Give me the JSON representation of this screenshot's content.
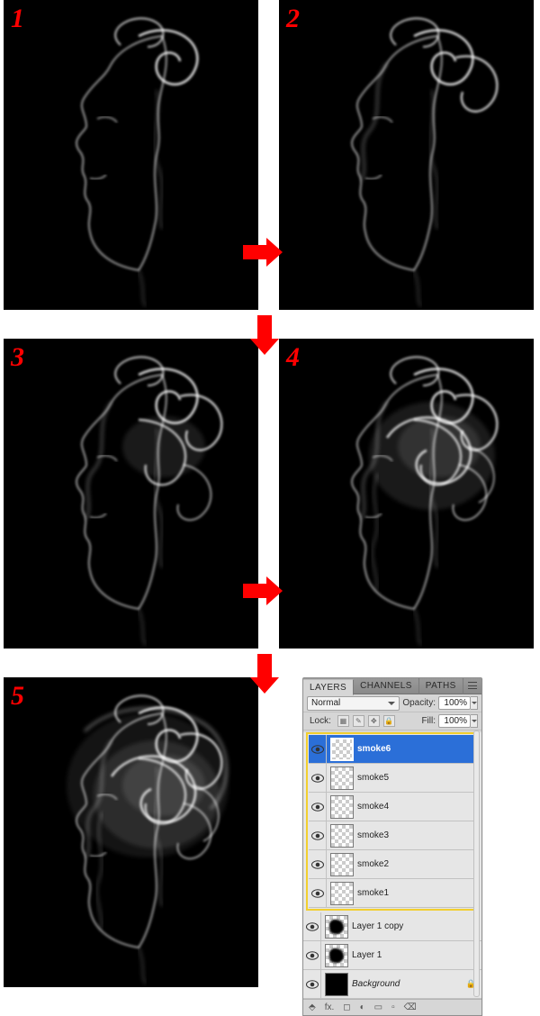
{
  "steps": {
    "n1": "1",
    "n2": "2",
    "n3": "3",
    "n4": "4",
    "n5": "5"
  },
  "panel": {
    "tabs": {
      "layers": "LAYERS",
      "channels": "CHANNELS",
      "paths": "PATHS"
    },
    "blend_mode": "Normal",
    "opacity_label": "Opacity:",
    "opacity_value": "100%",
    "lock_label": "Lock:",
    "fill_label": "Fill:",
    "fill_value": "100%",
    "layers": [
      {
        "name": "smoke6",
        "selected": true
      },
      {
        "name": "smoke5",
        "selected": false
      },
      {
        "name": "smoke4",
        "selected": false
      },
      {
        "name": "smoke3",
        "selected": false
      },
      {
        "name": "smoke2",
        "selected": false
      },
      {
        "name": "smoke1",
        "selected": false
      }
    ],
    "extra_layers": [
      {
        "name": "Layer 1 copy",
        "thumb": "blot"
      },
      {
        "name": "Layer 1",
        "thumb": "blot"
      },
      {
        "name": "Background",
        "thumb": "black",
        "locked": true,
        "italic": true
      }
    ],
    "foot": {
      "link": "⬘",
      "fx": "fx.",
      "mask": "◻",
      "adj": "◐",
      "folder": "▭",
      "new": "▫",
      "trash": "⌫"
    }
  }
}
